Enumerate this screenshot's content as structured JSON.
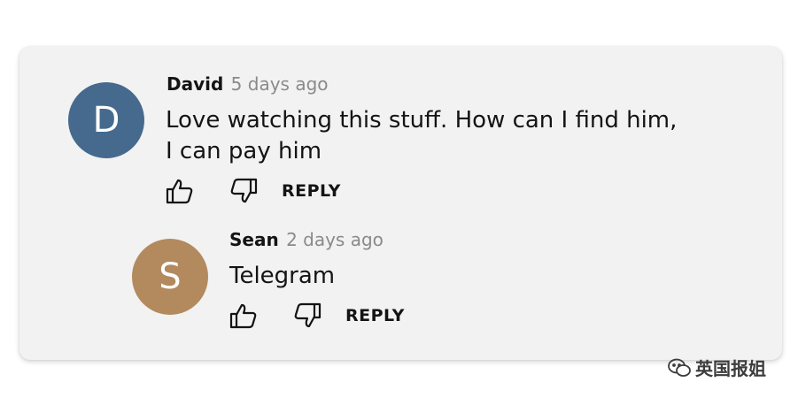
{
  "comments": [
    {
      "author": "David",
      "time": "5 days ago",
      "avatar_letter": "D",
      "avatar_color": "#456a8e",
      "text": "Love watching this stuff. How can I find him,\nI can pay him",
      "reply_label": "REPLY"
    },
    {
      "author": "Sean",
      "time": "2 days ago",
      "avatar_letter": "S",
      "avatar_color": "#b38a5e",
      "text": "Telegram",
      "reply_label": "REPLY"
    }
  ],
  "watermark": {
    "text": "英国报姐",
    "icon": "wechat-icon"
  },
  "icons": {
    "like": "thumbs-up-icon",
    "dislike": "thumbs-down-icon"
  }
}
